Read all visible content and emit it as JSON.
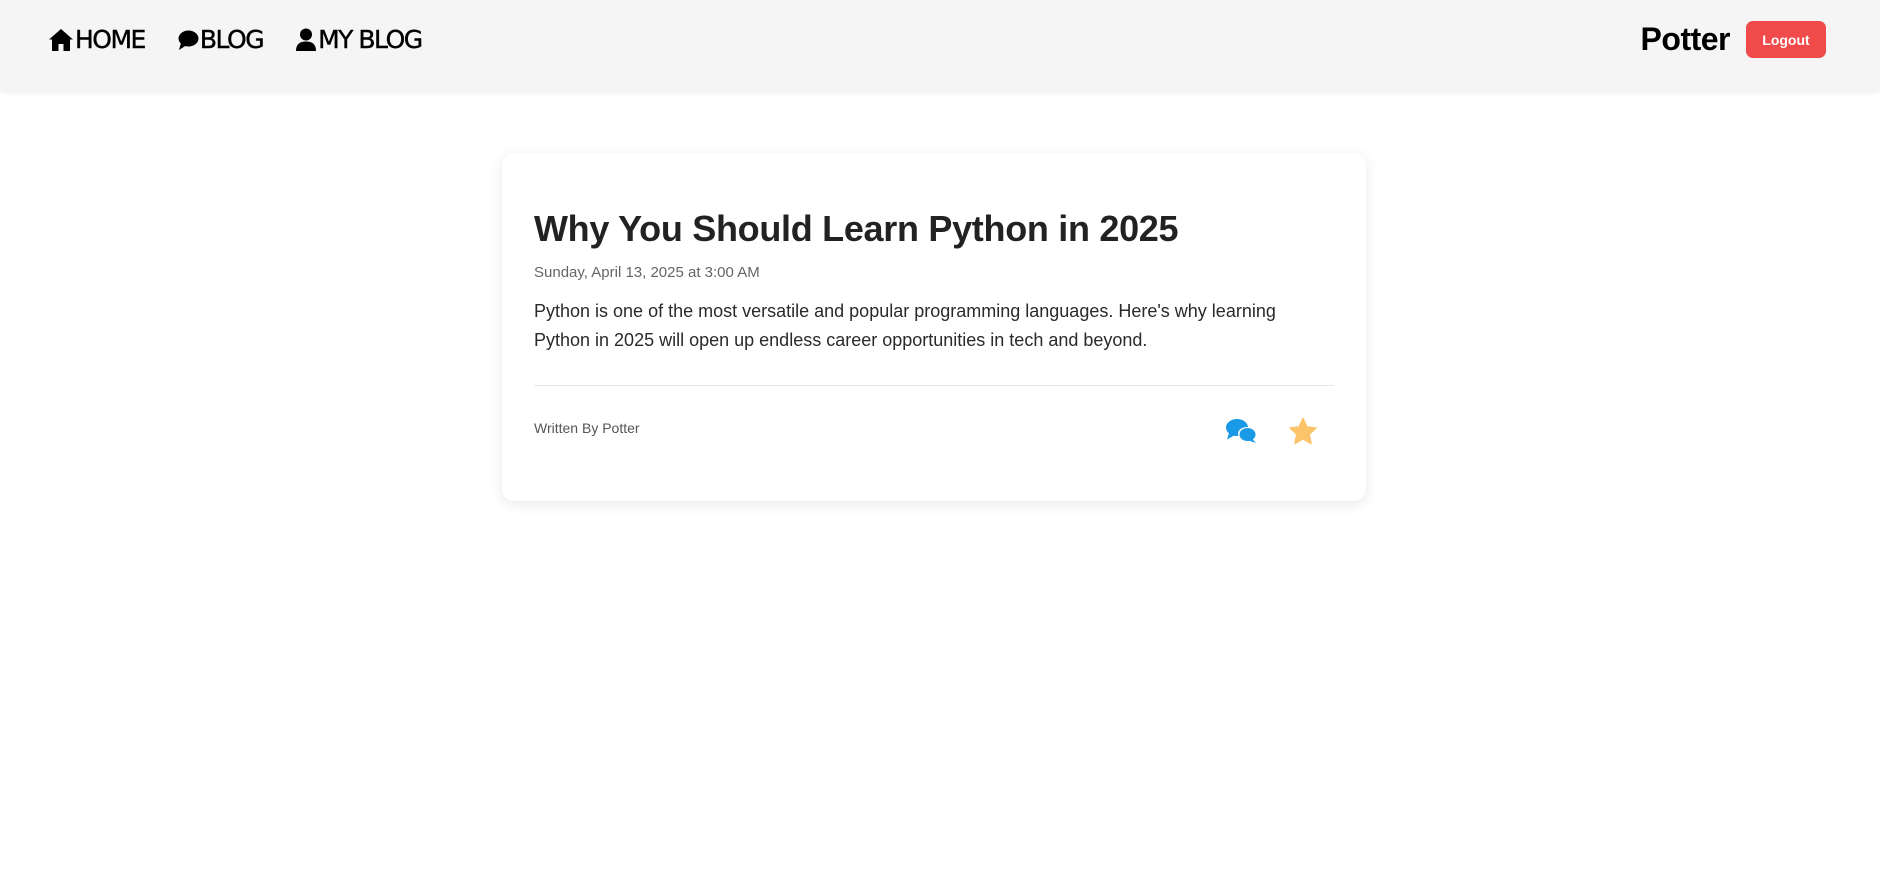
{
  "nav": {
    "home_label": "HOME",
    "blog_label": "BLOG",
    "my_blog_label": "MY BLOG",
    "home_icon": "home-icon",
    "blog_icon": "comment-icon",
    "my_blog_icon": "user-icon"
  },
  "user": {
    "name": "Potter",
    "logout_label": "Logout"
  },
  "post": {
    "title": "Why You Should Learn Python in 2025",
    "date": "Sunday, April 13, 2025 at 3:00 AM",
    "excerpt": "Python is one of the most versatile and popular programming languages. Here's why learning Python in 2025 will open up endless career opportunities in tech and beyond.",
    "author": "Written By Potter",
    "comments_icon": "comments-icon",
    "favorite_icon": "star-icon"
  },
  "colors": {
    "navbar_bg": "#f5f5f5",
    "logout_bg": "#f14a4a",
    "comments_icon": "#1a9ae6",
    "star_icon": "#fcc46a"
  }
}
